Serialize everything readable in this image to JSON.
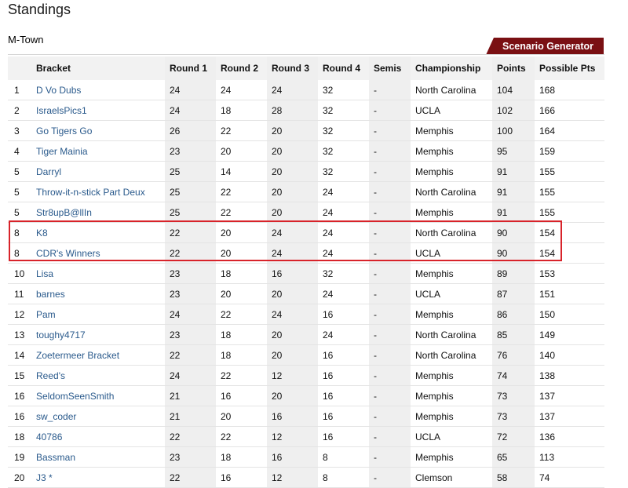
{
  "page": {
    "title": "Standings",
    "group_name": "M-Town",
    "scenario_button": "Scenario Generator"
  },
  "table": {
    "headers": [
      "",
      "Bracket",
      "Round 1",
      "Round 2",
      "Round 3",
      "Round 4",
      "Semis",
      "Championship",
      "Points",
      "Possible Pts"
    ],
    "rows": [
      [
        "1",
        "D Vo Dubs",
        "24",
        "24",
        "24",
        "32",
        "-",
        "North Carolina",
        "104",
        "168"
      ],
      [
        "2",
        "IsraelsPics1",
        "24",
        "18",
        "28",
        "32",
        "-",
        "UCLA",
        "102",
        "166"
      ],
      [
        "3",
        "Go Tigers Go",
        "26",
        "22",
        "20",
        "32",
        "-",
        "Memphis",
        "100",
        "164"
      ],
      [
        "4",
        "Tiger Mainia",
        "23",
        "20",
        "20",
        "32",
        "-",
        "Memphis",
        "95",
        "159"
      ],
      [
        "5",
        "Darryl",
        "25",
        "14",
        "20",
        "32",
        "-",
        "Memphis",
        "91",
        "155"
      ],
      [
        "5",
        "Throw-it-n-stick Part Deux",
        "25",
        "22",
        "20",
        "24",
        "-",
        "North Carolina",
        "91",
        "155"
      ],
      [
        "5",
        "Str8upB@llIn",
        "25",
        "22",
        "20",
        "24",
        "-",
        "Memphis",
        "91",
        "155"
      ],
      [
        "8",
        "K8",
        "22",
        "20",
        "24",
        "24",
        "-",
        "North Carolina",
        "90",
        "154"
      ],
      [
        "8",
        "CDR's Winners",
        "22",
        "20",
        "24",
        "24",
        "-",
        "UCLA",
        "90",
        "154"
      ],
      [
        "10",
        "Lisa",
        "23",
        "18",
        "16",
        "32",
        "-",
        "Memphis",
        "89",
        "153"
      ],
      [
        "11",
        "barnes",
        "23",
        "20",
        "20",
        "24",
        "-",
        "UCLA",
        "87",
        "151"
      ],
      [
        "12",
        "Pam",
        "24",
        "22",
        "24",
        "16",
        "-",
        "Memphis",
        "86",
        "150"
      ],
      [
        "13",
        "toughy4717",
        "23",
        "18",
        "20",
        "24",
        "-",
        "North Carolina",
        "85",
        "149"
      ],
      [
        "14",
        "Zoetermeer Bracket",
        "22",
        "18",
        "20",
        "16",
        "-",
        "North Carolina",
        "76",
        "140"
      ],
      [
        "15",
        "Reed's",
        "24",
        "22",
        "12",
        "16",
        "-",
        "Memphis",
        "74",
        "138"
      ],
      [
        "16",
        "SeldomSeenSmith",
        "21",
        "16",
        "20",
        "16",
        "-",
        "Memphis",
        "73",
        "137"
      ],
      [
        "16",
        "sw_coder",
        "21",
        "20",
        "16",
        "16",
        "-",
        "Memphis",
        "73",
        "137"
      ],
      [
        "18",
        "40786",
        "22",
        "22",
        "12",
        "16",
        "-",
        "UCLA",
        "72",
        "136"
      ],
      [
        "19",
        "Bassman",
        "23",
        "18",
        "16",
        "8",
        "-",
        "Memphis",
        "65",
        "113"
      ],
      [
        "20",
        "J3 *",
        "22",
        "16",
        "12",
        "8",
        "-",
        "Clemson",
        "58",
        "74"
      ]
    ]
  },
  "colors": {
    "accent": "#7a1013",
    "link": "#2a5a8c",
    "highlight": "#d8232a"
  }
}
